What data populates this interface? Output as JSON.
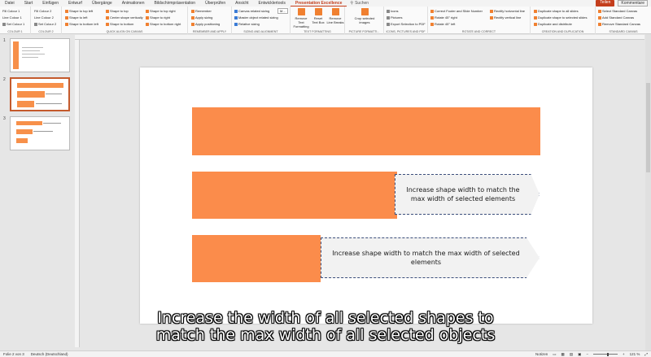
{
  "tabs": [
    "Datei",
    "Start",
    "Einfügen",
    "Entwurf",
    "Übergänge",
    "Animationen",
    "Bildschirmpräsentation",
    "Überprüfen",
    "Ansicht",
    "Entwicklertools",
    "Presentation Excellence"
  ],
  "search_label": "Suchen",
  "share_label": "Teilen",
  "comments_label": "Kommentare",
  "ribbon": {
    "colour1": {
      "items": [
        "Fill Colour 1",
        "Line Colour 1",
        "Set Colour 1"
      ],
      "label": "COLOUR 1"
    },
    "colour2": {
      "items": [
        "Fill Colour 2",
        "Line Colour 2",
        "Set Colour 2"
      ],
      "label": "COLOUR 2"
    },
    "align": {
      "col1": [
        "Shape to top left",
        "Shape to left",
        "Shape to bottom left"
      ],
      "col2": [
        "Shape to top",
        "Center shape vertically",
        "Shape to bottom"
      ],
      "col3": [
        "Shape to top right",
        "Shape to right",
        "Shape to bottom right"
      ],
      "label": "QUICK ALIGN ON CANVAS"
    },
    "remember": {
      "items": [
        "Remember",
        "Apply sizing",
        "Apply positioning"
      ],
      "label": "REMEMBER AND APPLY"
    },
    "sizing": {
      "items": [
        "Canvas related sizing",
        "Master object related sizing",
        "Relative sizing"
      ],
      "drop": "M...",
      "label": "SIZING AND ALIGNMENT"
    },
    "text": {
      "items": [
        "Remove Text Formatting",
        "Reset Text Box",
        "Remove Line Breaks"
      ],
      "label": "TEXT FORMATTING"
    },
    "picture": {
      "items": [
        "Crop selected images"
      ],
      "label": "PICTURE FORMATTI..."
    },
    "icons": {
      "items": [
        "Icons",
        "Pictures",
        "Export Selection to PDF"
      ],
      "label": "ICONS, PICTURES AND PDF"
    },
    "rotate": {
      "col1": [
        "Correct Footer and Slide Number",
        "Rotate 45° right",
        "Rotate 45° left"
      ],
      "col2": [
        "Rectify horizontal line",
        "Rectify vertical line"
      ],
      "label": "ROTATE AND CORRECT"
    },
    "creation": {
      "items": [
        "Duplicate shape to all slides",
        "Duplicate shape to selected slides",
        "Duplicate and distribute"
      ],
      "label": "CREATION AND DUPLICATION"
    },
    "canvas": {
      "items": [
        "Select Standard Canvas",
        "Add Standard Canvas",
        "Remove Standard Canvas"
      ],
      "label": "STANDARD CANVAS"
    }
  },
  "slides": [
    {
      "num": "1"
    },
    {
      "num": "2"
    },
    {
      "num": "3"
    }
  ],
  "slide": {
    "callout1": "Increase shape width to match the max width of selected elements",
    "callout2": "Increase shape width to match the max width of selected elements"
  },
  "caption": {
    "line1": "Increase the width of all selected shapes to",
    "line2": "match the max width of all selected objects"
  },
  "status": {
    "slide_info": "Folie 2 von 3",
    "language": "Deutsch (Deutschland)",
    "notes": "Notizen",
    "zoom": "121 %"
  },
  "colors": {
    "accent": "#c43e1c",
    "shape": "#fb8c4b",
    "callout_border": "#3c4f7c"
  }
}
